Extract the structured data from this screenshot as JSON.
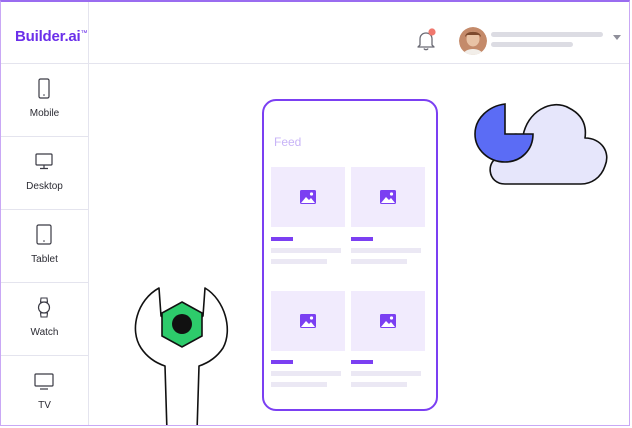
{
  "brand": {
    "name": "Builder.ai",
    "color": "#6b2fea"
  },
  "header": {
    "notification_dot_color": "#f0786e",
    "icons": [
      "bell-icon",
      "avatar",
      "chevron-down-icon"
    ]
  },
  "sidebar": {
    "items": [
      {
        "label": "Mobile",
        "icon": "mobile-icon"
      },
      {
        "label": "Desktop",
        "icon": "desktop-icon"
      },
      {
        "label": "Tablet",
        "icon": "tablet-icon"
      },
      {
        "label": "Watch",
        "icon": "watch-icon"
      },
      {
        "label": "TV",
        "icon": "tv-icon"
      }
    ]
  },
  "preview": {
    "feed_title": "Feed",
    "accent_color": "#7b3ff2",
    "cards": 4
  },
  "illustrations": [
    "wrench-icon",
    "cloud-icon",
    "moon-icon"
  ]
}
